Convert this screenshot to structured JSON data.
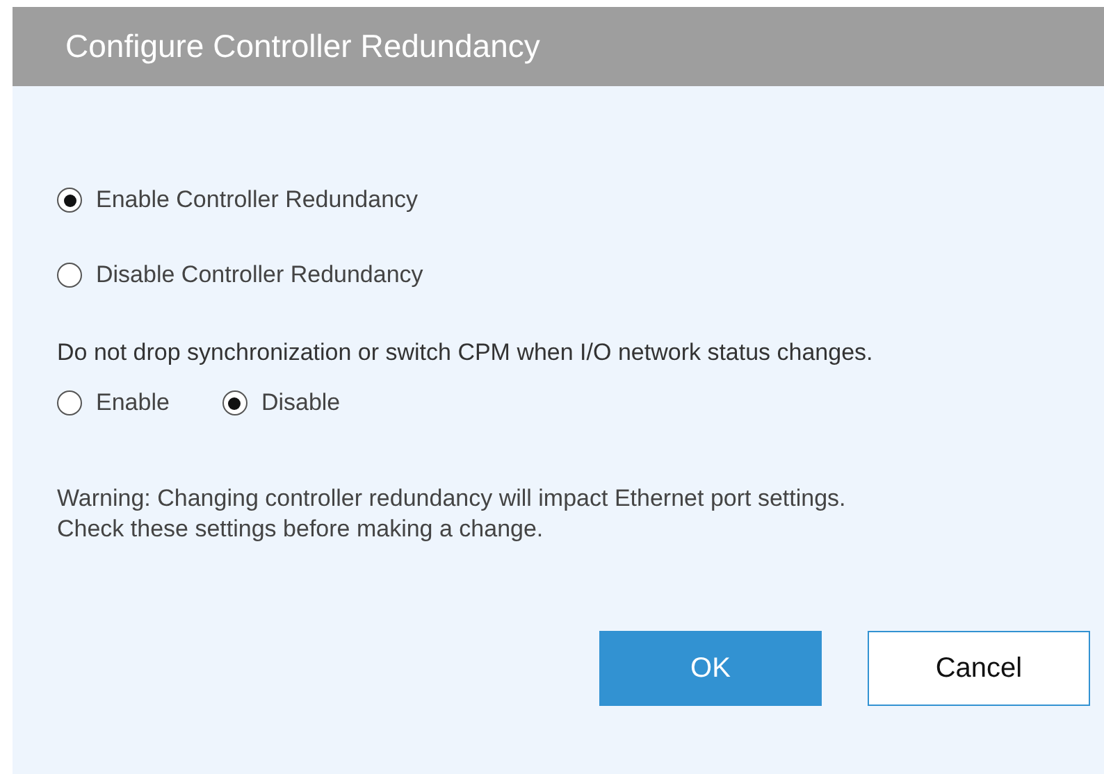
{
  "dialog": {
    "title": "Configure Controller Redundancy"
  },
  "redundancy_options": [
    {
      "label": "Enable Controller Redundancy",
      "selected": true
    },
    {
      "label": "Disable Controller Redundancy",
      "selected": false
    }
  ],
  "network_setting": {
    "description": "Do not drop synchronization or switch CPM when I/O network status changes.",
    "options": [
      {
        "label": "Enable",
        "selected": false
      },
      {
        "label": "Disable",
        "selected": true
      }
    ]
  },
  "warning": "Warning: Changing controller redundancy will impact Ethernet port settings.\nCheck these settings before making a change.",
  "buttons": [
    {
      "label": "OK",
      "kind": "primary"
    },
    {
      "label": "Cancel",
      "kind": "secondary"
    }
  ]
}
